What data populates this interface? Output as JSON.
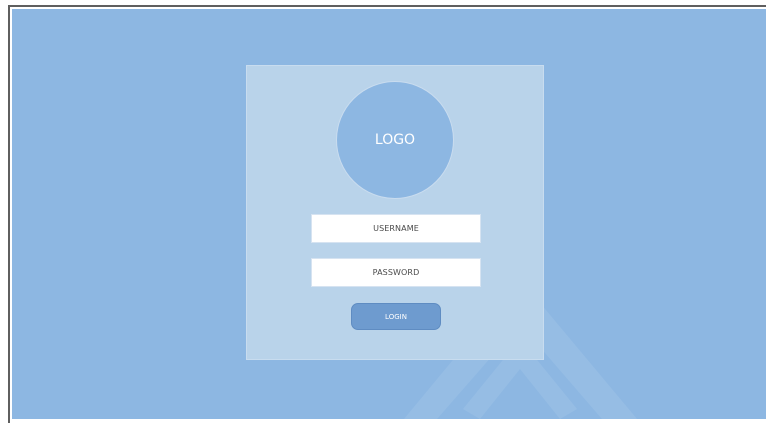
{
  "logo": {
    "label": "LOGO"
  },
  "form": {
    "username_placeholder": "USERNAME",
    "password_placeholder": "PASSWORD",
    "login_label": "LOGIN"
  },
  "colors": {
    "background": "#8db7e2",
    "card": "#b9d3ea",
    "button": "#6e9bcf",
    "field": "#ffffff"
  }
}
